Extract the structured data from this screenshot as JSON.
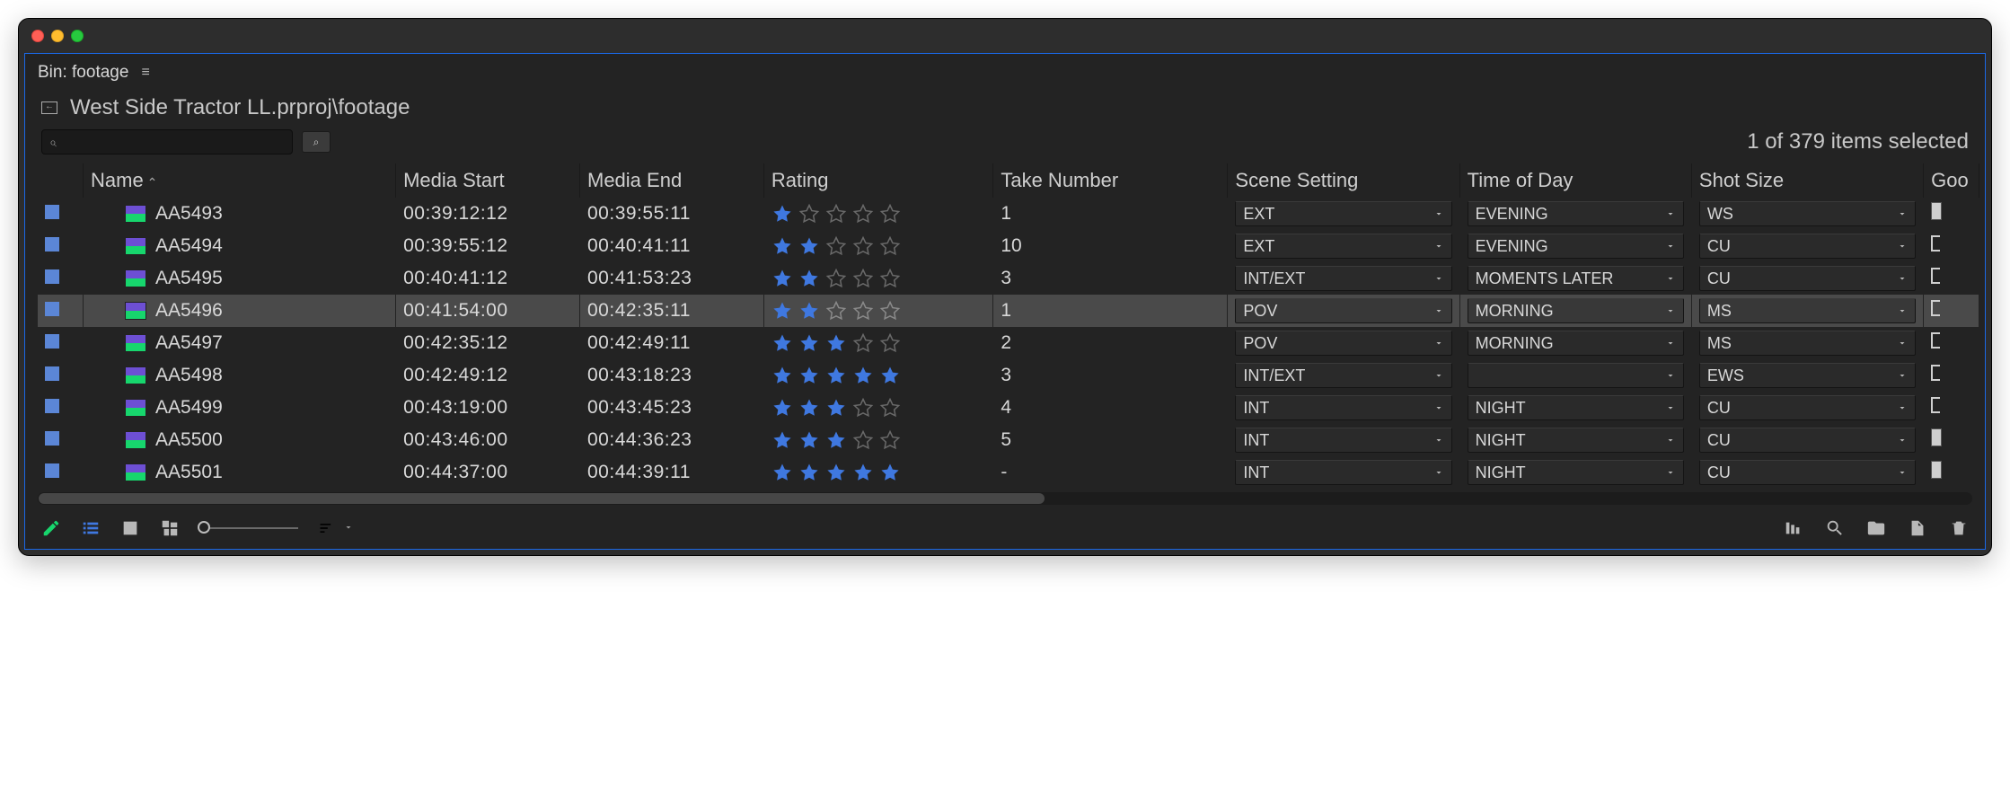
{
  "panel": {
    "title_prefix": "Bin:",
    "title_name": "footage",
    "breadcrumb": "West Side Tractor LL.prproj\\footage",
    "selection_status": "1 of 379 items selected"
  },
  "columns": {
    "name": "Name",
    "media_start": "Media Start",
    "media_end": "Media End",
    "rating": "Rating",
    "take_number": "Take Number",
    "scene_setting": "Scene Setting",
    "time_of_day": "Time of Day",
    "shot_size": "Shot Size",
    "good_partial": "Goo"
  },
  "rows": [
    {
      "name": "AA5493",
      "media_start": "00:39:12:12",
      "media_end": "00:39:55:11",
      "rating": 1,
      "take": "1",
      "scene": "EXT",
      "tod": "EVENING",
      "shot": "WS",
      "selected": false,
      "marker": "full"
    },
    {
      "name": "AA5494",
      "media_start": "00:39:55:12",
      "media_end": "00:40:41:11",
      "rating": 2,
      "take": "10",
      "scene": "EXT",
      "tod": "EVENING",
      "shot": "CU",
      "selected": false,
      "marker": "outline"
    },
    {
      "name": "AA5495",
      "media_start": "00:40:41:12",
      "media_end": "00:41:53:23",
      "rating": 2,
      "take": "3",
      "scene": "INT/EXT",
      "tod": "MOMENTS LATER",
      "shot": "CU",
      "selected": false,
      "marker": "outline"
    },
    {
      "name": "AA5496",
      "media_start": "00:41:54:00",
      "media_end": "00:42:35:11",
      "rating": 2,
      "take": "1",
      "scene": "POV",
      "tod": "MORNING",
      "shot": "MS",
      "selected": true,
      "marker": "outline"
    },
    {
      "name": "AA5497",
      "media_start": "00:42:35:12",
      "media_end": "00:42:49:11",
      "rating": 3,
      "take": "2",
      "scene": "POV",
      "tod": "MORNING",
      "shot": "MS",
      "selected": false,
      "marker": "outline"
    },
    {
      "name": "AA5498",
      "media_start": "00:42:49:12",
      "media_end": "00:43:18:23",
      "rating": 5,
      "take": "3",
      "scene": "INT/EXT",
      "tod": "",
      "shot": "EWS",
      "selected": false,
      "marker": "outline"
    },
    {
      "name": "AA5499",
      "media_start": "00:43:19:00",
      "media_end": "00:43:45:23",
      "rating": 3,
      "take": "4",
      "scene": "INT",
      "tod": "NIGHT",
      "shot": "CU",
      "selected": false,
      "marker": "outline"
    },
    {
      "name": "AA5500",
      "media_start": "00:43:46:00",
      "media_end": "00:44:36:23",
      "rating": 3,
      "take": "5",
      "scene": "INT",
      "tod": "NIGHT",
      "shot": "CU",
      "selected": false,
      "marker": "full"
    },
    {
      "name": "AA5501",
      "media_start": "00:44:37:00",
      "media_end": "00:44:39:11",
      "rating": 5,
      "take": "-",
      "scene": "INT",
      "tod": "NIGHT",
      "shot": "CU",
      "selected": false,
      "marker": "full"
    }
  ],
  "search": {
    "placeholder": ""
  }
}
